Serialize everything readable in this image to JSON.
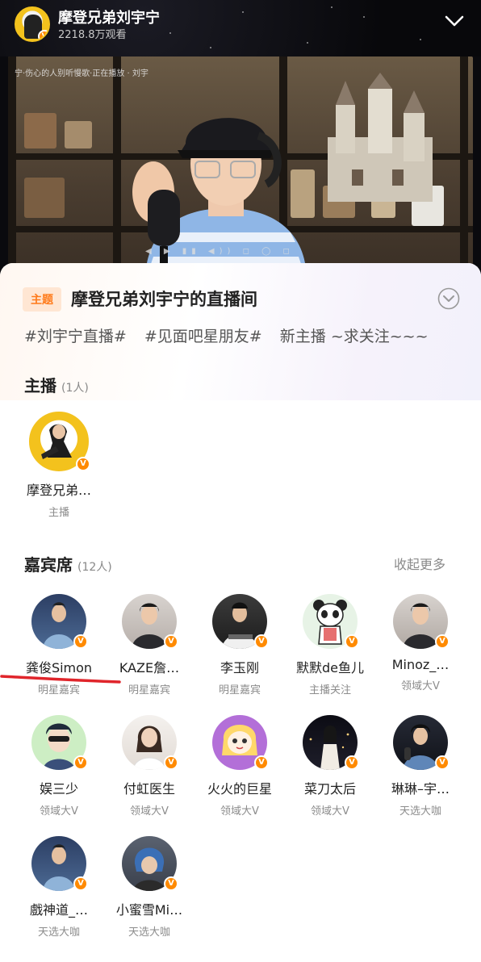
{
  "header": {
    "title": "摩登兄弟刘宇宁",
    "views": "2218.8万观看"
  },
  "video": {
    "caption": "宁·伤心的人别听慢歌·正在播放 · 刘宇"
  },
  "panel": {
    "topic_tag": "主题",
    "room_title": "摩登兄弟刘宇宁的直播间",
    "hashtags": [
      "#刘宇宁直播#",
      "#见面吧星朋友#",
      "新主播 ~求关注~~~"
    ]
  },
  "host_section": {
    "title": "主播",
    "count": "(1人)",
    "members": [
      {
        "name": "摩登兄弟…",
        "role": "主播",
        "badge": "V"
      }
    ]
  },
  "guest_section": {
    "title": "嘉宾席",
    "count": "(12人)",
    "collapse_label": "收起更多",
    "members": [
      {
        "name": "龚俊Simon",
        "role": "明星嘉宾",
        "badge": "V"
      },
      {
        "name": "KAZE詹…",
        "role": "明星嘉宾",
        "badge": "V"
      },
      {
        "name": "李玉刚",
        "role": "明星嘉宾",
        "badge": "V"
      },
      {
        "name": "默默de鱼儿",
        "role": "主播关注",
        "badge": "V"
      },
      {
        "name": "Minoz_…",
        "role": "领域大V",
        "badge": "V"
      },
      {
        "name": "娱三少",
        "role": "领域大V",
        "badge": "V"
      },
      {
        "name": "付虹医生",
        "role": "领域大V",
        "badge": "V"
      },
      {
        "name": "火火的巨星",
        "role": "领域大V",
        "badge": "V"
      },
      {
        "name": "菜刀太后",
        "role": "领域大V",
        "badge": "V"
      },
      {
        "name": "琳琳–宇…",
        "role": "天选大咖",
        "badge": "V"
      },
      {
        "name": "戲神道_…",
        "role": "天选大咖",
        "badge": "V"
      },
      {
        "name": "小蜜雪Mi…",
        "role": "天选大咖",
        "badge": "V"
      }
    ]
  },
  "colors": {
    "accent_orange": "#ff8a00",
    "topic_bg": "#ffe6d3",
    "topic_text": "#ff7a1a",
    "underline_red": "#e0252b"
  }
}
